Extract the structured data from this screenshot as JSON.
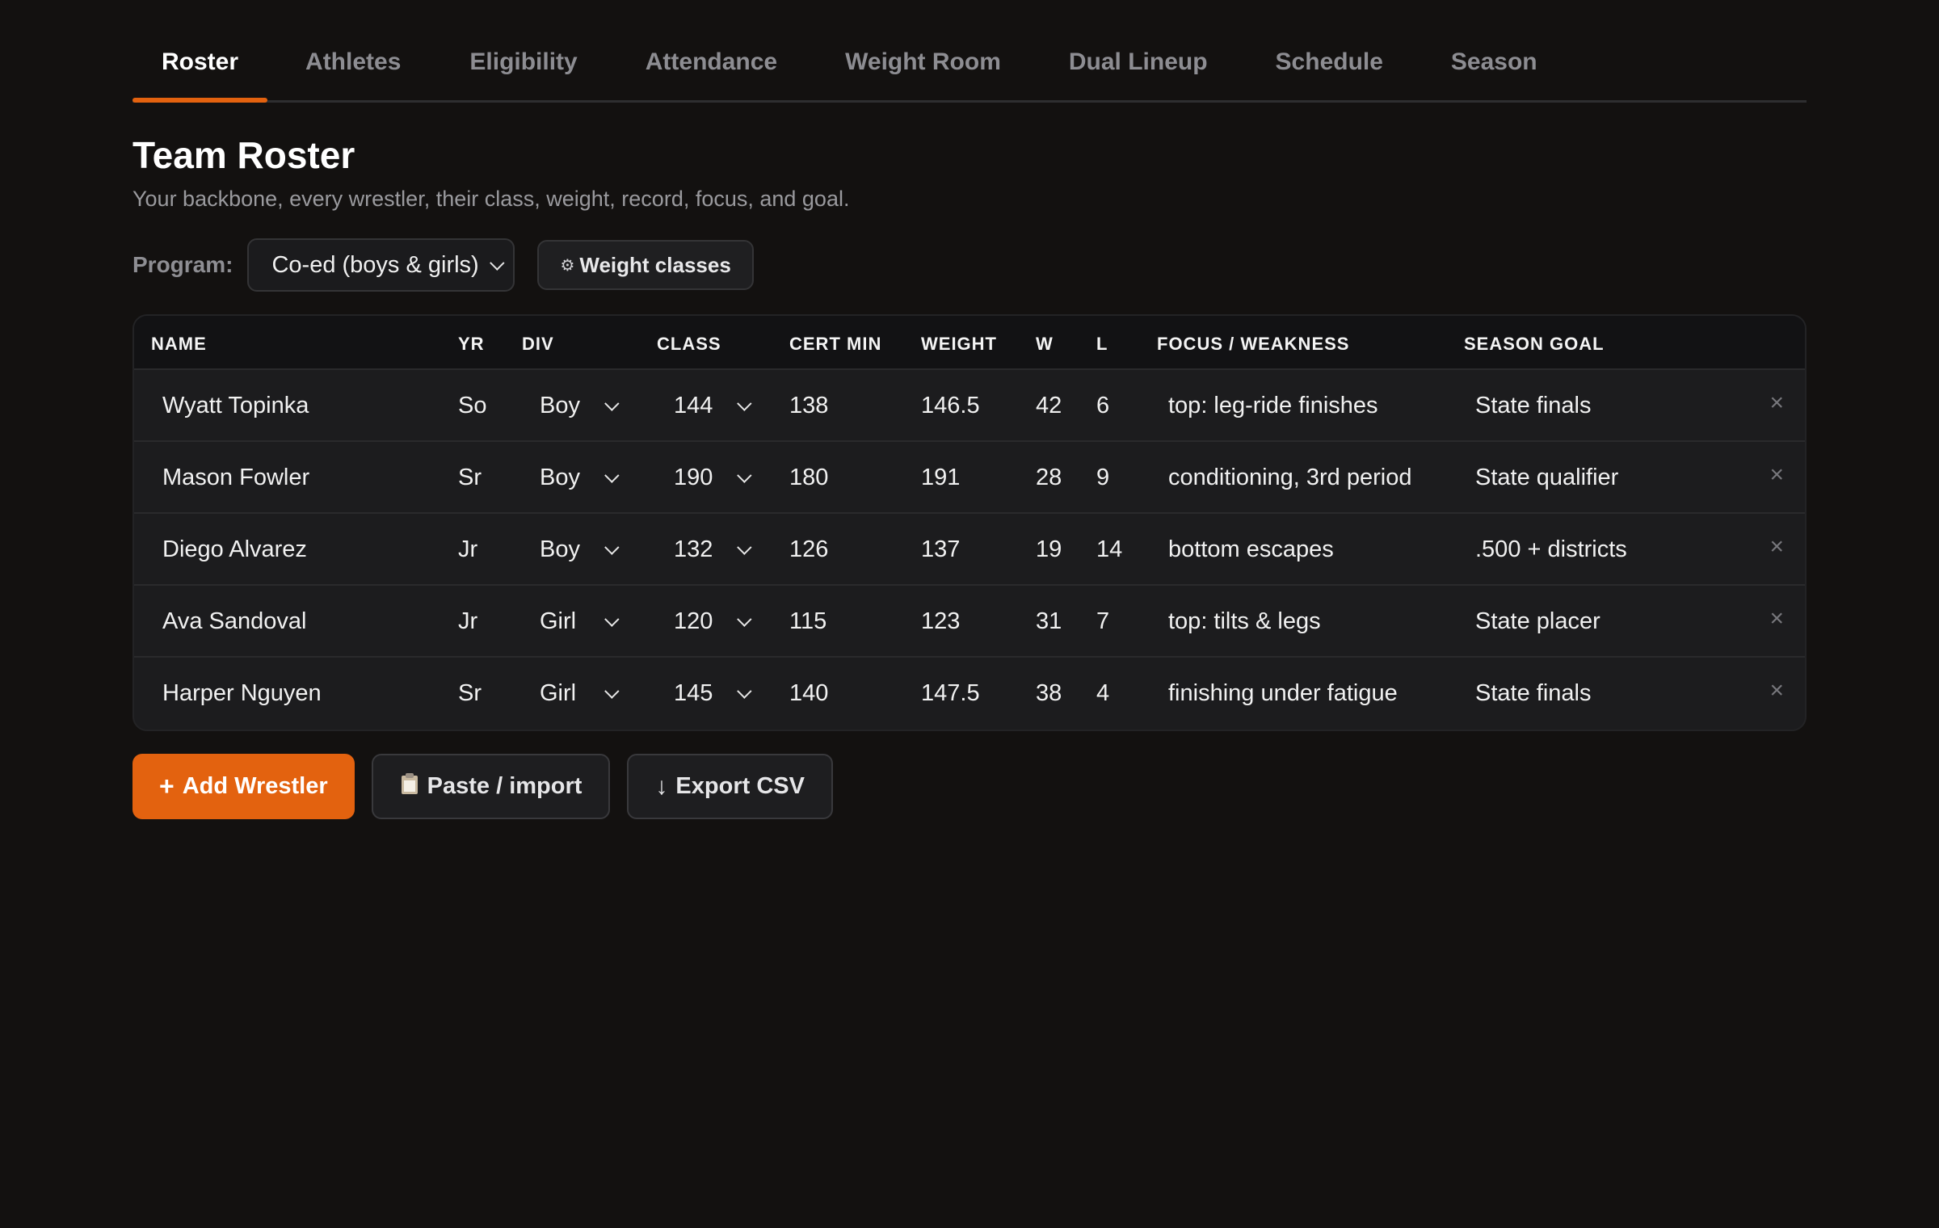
{
  "tabs": [
    {
      "label": "Roster"
    },
    {
      "label": "Athletes"
    },
    {
      "label": "Eligibility"
    },
    {
      "label": "Attendance"
    },
    {
      "label": "Weight Room"
    },
    {
      "label": "Dual Lineup"
    },
    {
      "label": "Schedule"
    },
    {
      "label": "Season"
    }
  ],
  "active_tab": "Roster",
  "page": {
    "title": "Team Roster",
    "subtitle": "Your backbone, every wrestler, their class, weight, record, focus, and goal."
  },
  "program": {
    "label": "Program:",
    "selected": "Co-ed (boys & girls)",
    "weight_classes_button": "Weight classes",
    "weight_classes_icon": "gear-icon"
  },
  "table": {
    "headers": {
      "name": "NAME",
      "yr": "YR",
      "div": "DIV",
      "class": "CLASS",
      "cert_min": "CERT MIN",
      "weight": "WEIGHT",
      "w": "W",
      "l": "L",
      "focus": "FOCUS / WEAKNESS",
      "goal": "SEASON GOAL"
    },
    "rows": [
      {
        "name": "Wyatt Topinka",
        "yr": "So",
        "div": "Boy",
        "class": "144",
        "cert_min": "138",
        "weight": "146.5",
        "w": "42",
        "l": "6",
        "focus": "top: leg-ride finishes",
        "goal": "State finals"
      },
      {
        "name": "Mason Fowler",
        "yr": "Sr",
        "div": "Boy",
        "class": "190",
        "cert_min": "180",
        "weight": "191",
        "w": "28",
        "l": "9",
        "focus": "conditioning, 3rd period",
        "goal": "State qualifier"
      },
      {
        "name": "Diego Alvarez",
        "yr": "Jr",
        "div": "Boy",
        "class": "132",
        "cert_min": "126",
        "weight": "137",
        "w": "19",
        "l": "14",
        "focus": "bottom escapes",
        "goal": ".500 + districts"
      },
      {
        "name": "Ava Sandoval",
        "yr": "Jr",
        "div": "Girl",
        "class": "120",
        "cert_min": "115",
        "weight": "123",
        "w": "31",
        "l": "7",
        "focus": "top: tilts & legs",
        "goal": "State placer"
      },
      {
        "name": "Harper Nguyen",
        "yr": "Sr",
        "div": "Girl",
        "class": "145",
        "cert_min": "140",
        "weight": "147.5",
        "w": "38",
        "l": "4",
        "focus": "finishing under fatigue",
        "goal": "State finals"
      }
    ],
    "delete_glyph": "×"
  },
  "actions": {
    "add": "Add Wrestler",
    "add_icon": "plus-icon",
    "paste": "Paste / import",
    "paste_icon": "clipboard-icon",
    "export": "Export CSV",
    "export_icon": "download-arrow-icon"
  },
  "colors": {
    "accent": "#e3620f",
    "background": "#131110",
    "surface": "#1c1c1e"
  }
}
